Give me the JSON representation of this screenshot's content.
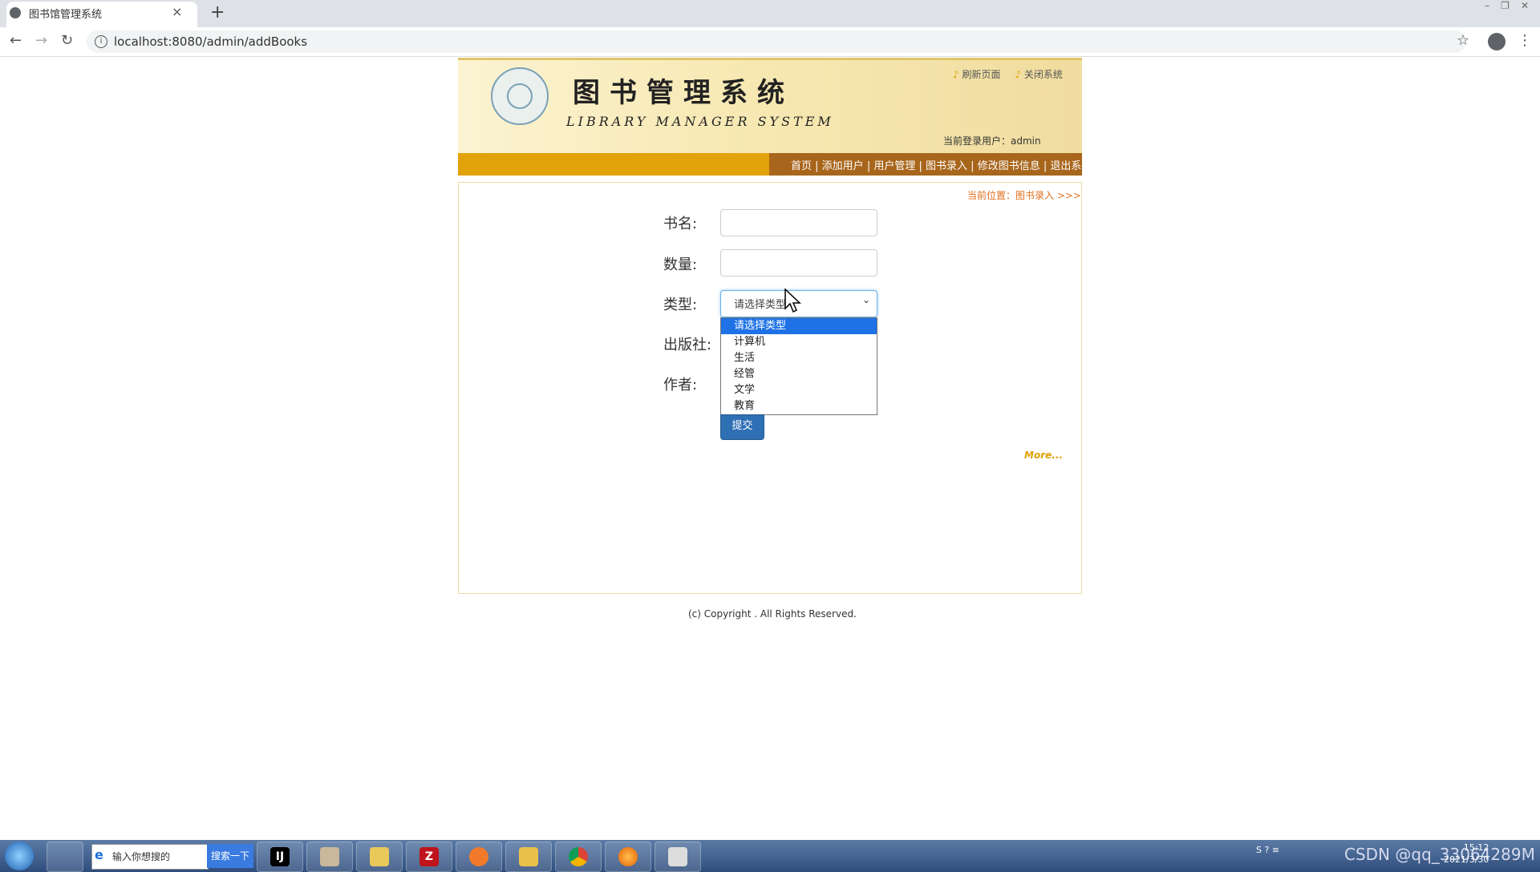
{
  "browser": {
    "tab_title": "图书馆管理系统",
    "tab_close": "×",
    "new_tab": "+",
    "window_controls": [
      "–",
      "❐",
      "✕"
    ],
    "back": "←",
    "forward": "→",
    "reload": "↻",
    "url": "localhost:8080/admin/addBooks",
    "star": "☆",
    "menu": "⋮"
  },
  "header": {
    "title": "图书管理系统",
    "subtitle": "LIBRARY MANAGER SYSTEM",
    "top_links": [
      "刷新页面",
      "关闭系统"
    ],
    "current_user": "当前登录用户：admin"
  },
  "nav": {
    "links": [
      "首页",
      "添加用户",
      "用户管理",
      "图书录入",
      "修改图书信息",
      "退出系统"
    ],
    "text": "首页 | 添加用户 | 用户管理 | 图书录入 | 修改图书信息 | 退出系统"
  },
  "breadcrumb": "当前位置：图书录入 >>>",
  "form": {
    "name_label": "书名:",
    "name_value": "",
    "quantity_label": "数量:",
    "quantity_value": "",
    "type_label": "类型:",
    "type_selected": "请选择类型",
    "type_options": [
      "请选择类型",
      "计算机",
      "生活",
      "经管",
      "文学",
      "教育"
    ],
    "publisher_label": "出版社:",
    "author_label": "作者:",
    "submit_label": "提交"
  },
  "more_link": "More...",
  "footer": {
    "copyright": "(c) Copyright . All Rights Reserved."
  },
  "taskbar": {
    "search_placeholder": "输入你想搜的",
    "search_button": "搜索一下",
    "apps": [
      "IntelliJ IDEA",
      "user",
      "explorer",
      "FileZilla",
      "app",
      "folder",
      "Chrome",
      "Firefox",
      "tool"
    ],
    "app_glyphs": [
      "IJ",
      "",
      "",
      "Z",
      "",
      "",
      "",
      "",
      ""
    ],
    "tray_text": "S ? ≡",
    "clock_time": "15:12",
    "clock_date": "2021/3/30",
    "watermark": "CSDN @qq_33064289M"
  },
  "colors": {
    "nav_gold": "#e2a20a",
    "nav_brown": "#a8661c",
    "breadcrumb": "#e07020",
    "select_highlight": "#1e72e6",
    "submit_blue": "#2f6fb3"
  }
}
